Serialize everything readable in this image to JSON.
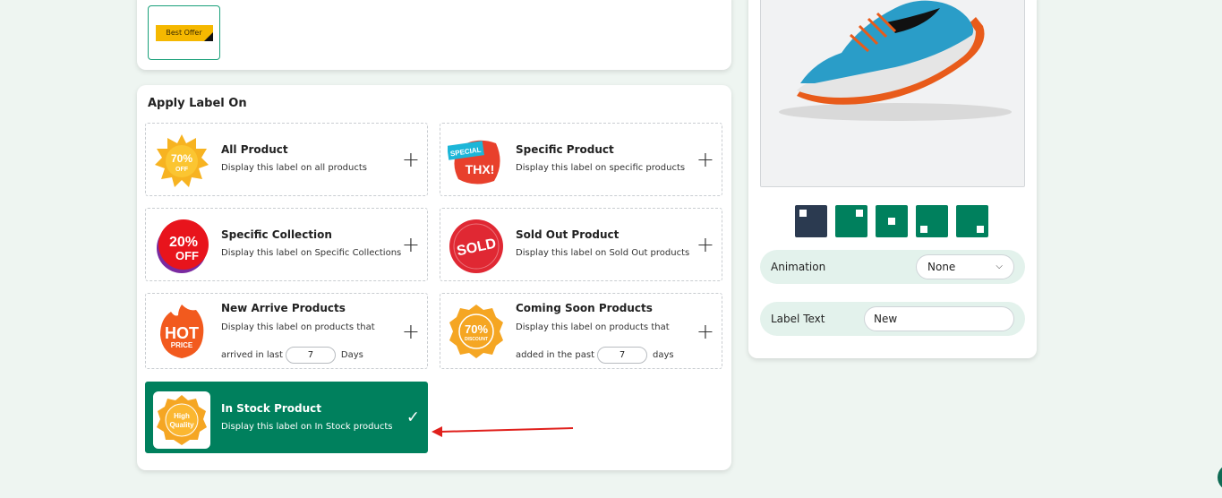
{
  "top_card": {
    "badge_text": "Best Offer"
  },
  "apply": {
    "title": "Apply Label On",
    "options": [
      {
        "title": "All Product",
        "desc": "Display this label on all products",
        "icon": "70-off-star-icon",
        "icon_text": "70%",
        "icon_sub": "OFF"
      },
      {
        "title": "Specific Product",
        "desc": "Display this label on specific products",
        "icon": "special-thx-icon",
        "icon_text": "SPECIAL",
        "icon_sub": "THX!"
      },
      {
        "title": "Specific Collection",
        "desc": "Display this label on Specific Collections",
        "icon": "20-off-icon",
        "icon_text": "20%",
        "icon_sub": "OFF"
      },
      {
        "title": "Sold Out Product",
        "desc": "Display this label on Sold Out products",
        "icon": "sold-icon",
        "icon_text": "SOLD"
      },
      {
        "title": "New Arrive Products",
        "desc": "Display this label on products that",
        "desc2_pre": "arrived in last",
        "days": "7",
        "desc2_post": "Days",
        "icon": "hot-price-icon",
        "icon_text": "HOT",
        "icon_sub": "PRICE"
      },
      {
        "title": "Coming Soon Products",
        "desc": "Display this label on products that",
        "desc2_pre": "added in the past",
        "days": "7",
        "desc2_post": "days",
        "icon": "70-discount-icon",
        "icon_text": "70%",
        "icon_sub": "DISCOUNT"
      },
      {
        "title": "In Stock Product",
        "desc": "Display this label on In Stock products",
        "icon": "high-quality-icon",
        "icon_text": "High",
        "icon_sub": "Quality",
        "selected": true
      }
    ]
  },
  "right_panel": {
    "animation_label": "Animation",
    "animation_value": "None",
    "label_text_label": "Label Text",
    "label_text_value": "New"
  },
  "colors": {
    "accent": "#00805d",
    "active_position": "#2b3a50",
    "arrow": "#e0201c"
  }
}
